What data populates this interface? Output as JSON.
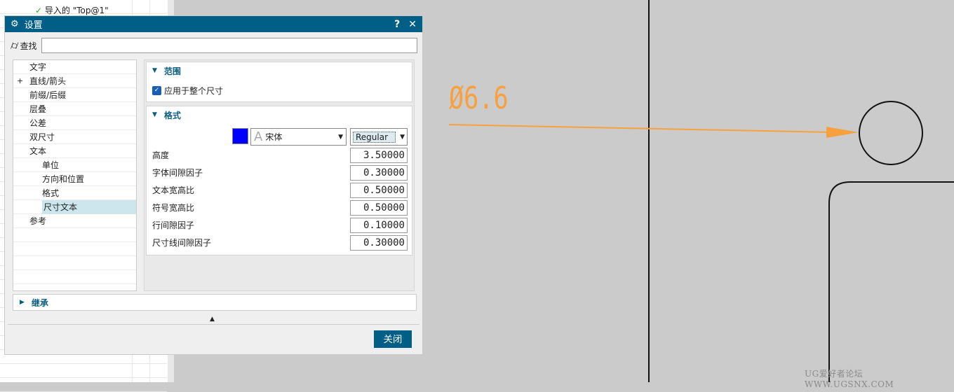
{
  "navigator": {
    "item_label": "导入的 \"Top@1\""
  },
  "dialog": {
    "title": "设置",
    "help": "?",
    "close": "✕",
    "find_label": "查找",
    "find_value": "",
    "tree": [
      {
        "label": "文字",
        "level": 0
      },
      {
        "label": "直线/箭头",
        "level": 0,
        "expandable": true
      },
      {
        "label": "前缀/后缀",
        "level": 0
      },
      {
        "label": "层叠",
        "level": 0
      },
      {
        "label": "公差",
        "level": 0
      },
      {
        "label": "双尺寸",
        "level": 0
      },
      {
        "label": "文本",
        "level": 0,
        "expanded": true
      },
      {
        "label": "单位",
        "level": 1
      },
      {
        "label": "方向和位置",
        "level": 1
      },
      {
        "label": "格式",
        "level": 1
      },
      {
        "label": "尺寸文本",
        "level": 1,
        "selected": true
      },
      {
        "label": "参考",
        "level": 0
      }
    ],
    "scope": {
      "title": "范围",
      "apply_label": "应用于整个尺寸",
      "apply_checked": true
    },
    "format": {
      "title": "格式",
      "color": "#0000ff",
      "font": "宋体",
      "style": "Regular",
      "fields": [
        {
          "label": "高度",
          "value": "3.50000"
        },
        {
          "label": "字体间隙因子",
          "value": "0.30000"
        },
        {
          "label": "文本宽高比",
          "value": "0.50000"
        },
        {
          "label": "符号宽高比",
          "value": "0.50000"
        },
        {
          "label": "行间隙因子",
          "value": "0.10000"
        },
        {
          "label": "尺寸线间隙因子",
          "value": "0.30000"
        }
      ]
    },
    "inherit_title": "继承",
    "close_button": "关闭"
  },
  "drawing": {
    "dimension_text": "Ø6.6",
    "annotation_color": "#f7a040"
  },
  "watermark": "UG爱好者论坛 WWW.UGSNX.COM"
}
